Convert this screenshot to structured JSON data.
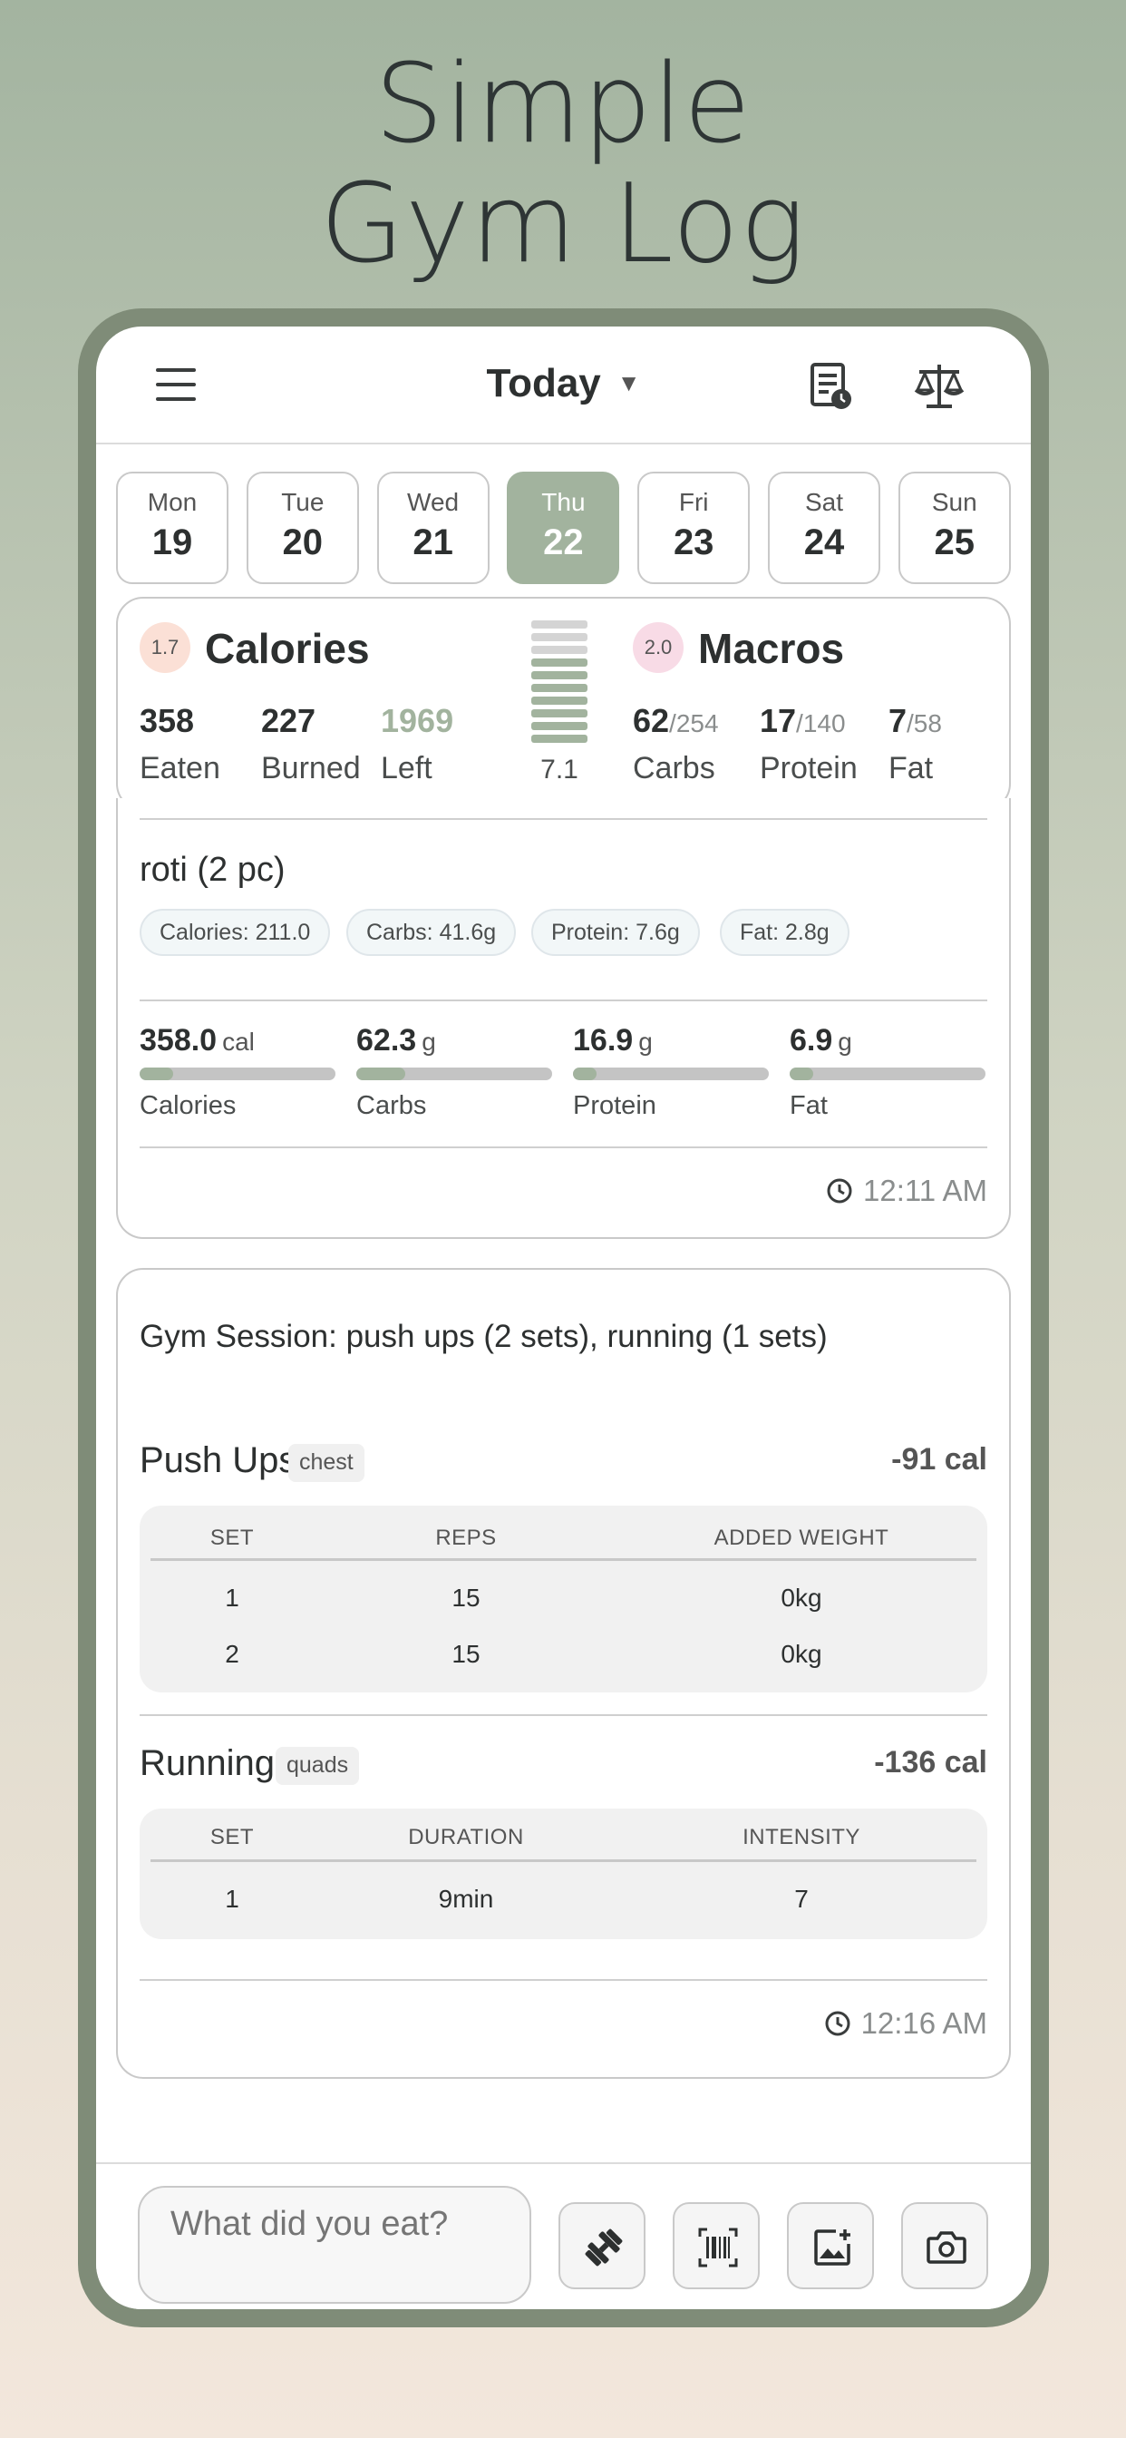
{
  "hero": {
    "line1": "Simple",
    "line2": "Gym Log"
  },
  "topbar": {
    "title": "Today",
    "caret": "▼"
  },
  "days": [
    {
      "name": "Mon",
      "date": "19",
      "active": false
    },
    {
      "name": "Tue",
      "date": "20",
      "active": false
    },
    {
      "name": "Wed",
      "date": "21",
      "active": false
    },
    {
      "name": "Thu",
      "date": "22",
      "active": true
    },
    {
      "name": "Fri",
      "date": "23",
      "active": false
    },
    {
      "name": "Sat",
      "date": "24",
      "active": false
    },
    {
      "name": "Sun",
      "date": "25",
      "active": false
    }
  ],
  "summary": {
    "calories": {
      "badge": "1.7",
      "title": "Calories",
      "eaten": "358",
      "eaten_label": "Eaten",
      "burned": "227",
      "burned_label": "Burned",
      "left": "1969",
      "left_label": "Left"
    },
    "ladder_value": "7.1",
    "macros": {
      "badge": "2.0",
      "title": "Macros",
      "carbs": "62",
      "carbs_total": "/254",
      "carbs_label": "Carbs",
      "protein": "17",
      "protein_total": "/140",
      "protein_label": "Protein",
      "fat": "7",
      "fat_total": "/58",
      "fat_label": "Fat"
    }
  },
  "food": {
    "name": "roti (2 pc)",
    "chips": [
      "Calories: 211.0",
      "Carbs: 41.6g",
      "Protein: 7.6g",
      "Fat: 2.8g"
    ],
    "totals": [
      {
        "value": "358.0",
        "unit": "cal",
        "label": "Calories",
        "fill": 0.17
      },
      {
        "value": "62.3",
        "unit": "g",
        "label": "Carbs",
        "fill": 0.25
      },
      {
        "value": "16.9",
        "unit": "g",
        "label": "Protein",
        "fill": 0.12
      },
      {
        "value": "6.9",
        "unit": "g",
        "label": "Fat",
        "fill": 0.12
      }
    ],
    "time": "12:11 AM"
  },
  "gym": {
    "summary": "Gym Session: push ups (2 sets), running (1 sets)",
    "exercises": [
      {
        "name": "Push Ups",
        "tag": "chest",
        "calories": "-91 cal",
        "headers": [
          "SET",
          "REPS",
          "ADDED WEIGHT"
        ],
        "rows": [
          [
            "1",
            "15",
            "0kg"
          ],
          [
            "2",
            "15",
            "0kg"
          ]
        ]
      },
      {
        "name": "Running",
        "tag": "quads",
        "calories": "-136 cal",
        "headers": [
          "SET",
          "DURATION",
          "INTENSITY"
        ],
        "rows": [
          [
            "1",
            "9min",
            "7"
          ]
        ]
      }
    ],
    "time": "12:16 AM"
  },
  "bottom": {
    "placeholder": "What did you eat?"
  },
  "colors": {
    "accent": "#a2b39e",
    "frame": "#7f8c78",
    "calories_badge": "#fbe0d6",
    "macros_badge": "#f8dbe6"
  }
}
